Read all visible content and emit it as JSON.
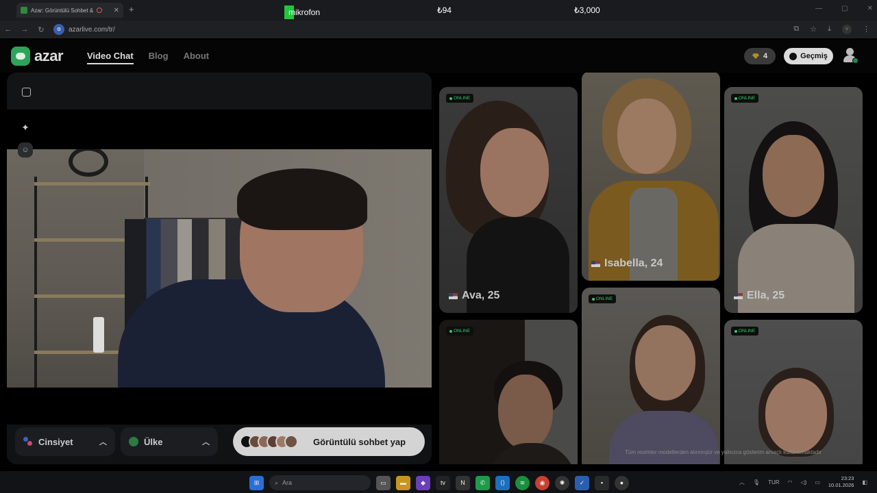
{
  "browser": {
    "tab_title": "Azar: Görüntülü Sohbet &",
    "url": "azarlive.com/tr/"
  },
  "overlay": {
    "mic_label": "mikrofon",
    "price_1": "₺94",
    "price_2": "₺3,000"
  },
  "header": {
    "logo_text": "azar",
    "nav": [
      "Video Chat",
      "Blog",
      "About"
    ],
    "gems": "4",
    "history_label": "Geçmiş"
  },
  "controls": {
    "gender_label": "Cinsiyet",
    "country_label": "Ülke",
    "start_label": "Görüntülü sohbet yap"
  },
  "cards": [
    {
      "name": "Ava, 25",
      "online": "ONLINE"
    },
    {
      "name": "Isabella, 24",
      "online": ""
    },
    {
      "name": "Ella, 25",
      "online": "ONLINE"
    },
    {
      "name": "",
      "online": "ONLINE"
    },
    {
      "name": "",
      "online": "ONLINE"
    },
    {
      "name": "",
      "online": "ONLINE"
    }
  ],
  "disclaimer": "Tüm resimler modellerden alınmıştır ve yalnızca gösterim amaçlı kullanılmaktadır",
  "taskbar": {
    "search_placeholder": "Ara",
    "language": "TUR",
    "time": "23:23",
    "date": "10.01.2026"
  },
  "colors": {
    "accent_green": "#2ea35a",
    "online_green": "#2fd06a",
    "mic_indicator": "#1ec83c"
  }
}
